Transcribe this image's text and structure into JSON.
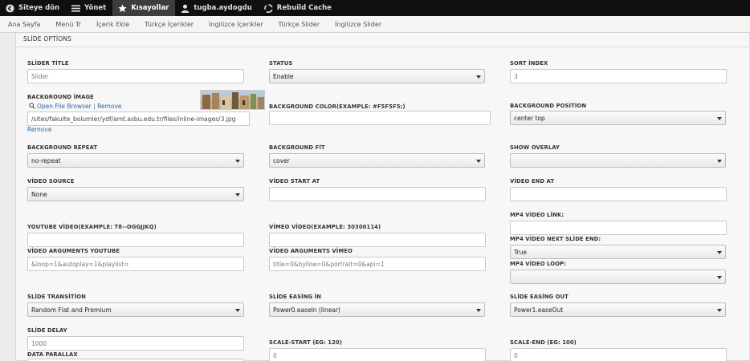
{
  "toolbar": {
    "items": [
      {
        "label": "Siteye dön",
        "icon": "back-circle-icon"
      },
      {
        "label": "Yönet",
        "icon": "menu-icon"
      },
      {
        "label": "Kısayollar",
        "icon": "star-icon"
      },
      {
        "label": "tugba.aydogdu",
        "icon": "user-icon"
      },
      {
        "label": "Rebuild Cache",
        "icon": "recycle-icon"
      }
    ]
  },
  "shortcuts": [
    "Ana Sayfa",
    "Menü Tr",
    "İçerik Ekle",
    "Türkçe İçerikler",
    "İngilizce İçerikler",
    "Türkçe Slider",
    "İngilizce Slider"
  ],
  "form": {
    "legend": "SLİDE OPTİONS",
    "slider_title": {
      "label": "SLİDER TİTLE",
      "value": "Slider"
    },
    "status": {
      "label": "STATUS",
      "value": "Enable"
    },
    "sort_index": {
      "label": "SORT İNDEX",
      "value": "3"
    },
    "background_image": {
      "label": "BACKGROUND İMAGE",
      "open_browser": "Open File Browser",
      "separator": "|",
      "remove_top": "Remove",
      "path": "/sites/fakulte_bolumler/ydf/amt.asbu.edu.tr/files/inline-images/3.jpg",
      "remove_bottom": "Remove"
    },
    "background_color": {
      "label": "BACKGROUND COLOR(EXAMPLE: #F5F5F5;)",
      "value": ""
    },
    "background_position": {
      "label": "BACKGROUND POSİTİON",
      "value": "center top"
    },
    "background_repeat": {
      "label": "BACKGROUND REPEAT",
      "value": "no-repeat"
    },
    "background_fit": {
      "label": "BACKGROUND FİT",
      "value": "cover"
    },
    "show_overlay": {
      "label": "SHOW OVERLAY",
      "value": ""
    },
    "video_source": {
      "label": "VİDEO SOURCE",
      "value": "None"
    },
    "video_start": {
      "label": "VİDEO START AT",
      "value": ""
    },
    "video_end": {
      "label": "VİDEO END AT",
      "value": ""
    },
    "youtube_video": {
      "label": "YOUTUBE VİDEO(EXAMPLE: T8--OGGJJKQ)",
      "value": ""
    },
    "vimeo_video": {
      "label": "VİMEO VİDEO(EXAMPLE: 30300114)",
      "value": ""
    },
    "mp4_link": {
      "label": "MP4 VİDEO LİNK:",
      "value": ""
    },
    "mp4_next": {
      "label": "MP4 VİDEO NEXT SLİDE END:",
      "value": "True"
    },
    "video_args_youtube": {
      "label": "VİDEO ARGUMENTS YOUTUBE",
      "value": "&loop=1&autoplay=1&playlist="
    },
    "video_args_vimeo": {
      "label": "VİDEO ARGUMENTS VİMEO",
      "value": "title=0&byline=0&portrait=0&api=1"
    },
    "mp4_loop": {
      "label": "MP4 VİDEO LOOP:",
      "value": ""
    },
    "slide_transition": {
      "label": "SLİDE TRANSİTİON",
      "value": "Random Flat and Premium"
    },
    "easing_in": {
      "label": "SLİDE EASİNG İN",
      "value": "Power0.easeIn (linear)"
    },
    "easing_out": {
      "label": "SLİDE EASİNG OUT",
      "value": "Power1.easeOut"
    },
    "slide_delay": {
      "label": "SLİDE DELAY",
      "value": "1000"
    },
    "data_parallax": {
      "label": "DATA PARALLAX"
    },
    "scale_start": {
      "label": "SCALE-START (EG: 120)",
      "value": "0"
    },
    "scale_end": {
      "label": "SCALE-END (EG: 100)",
      "value": "0"
    }
  }
}
